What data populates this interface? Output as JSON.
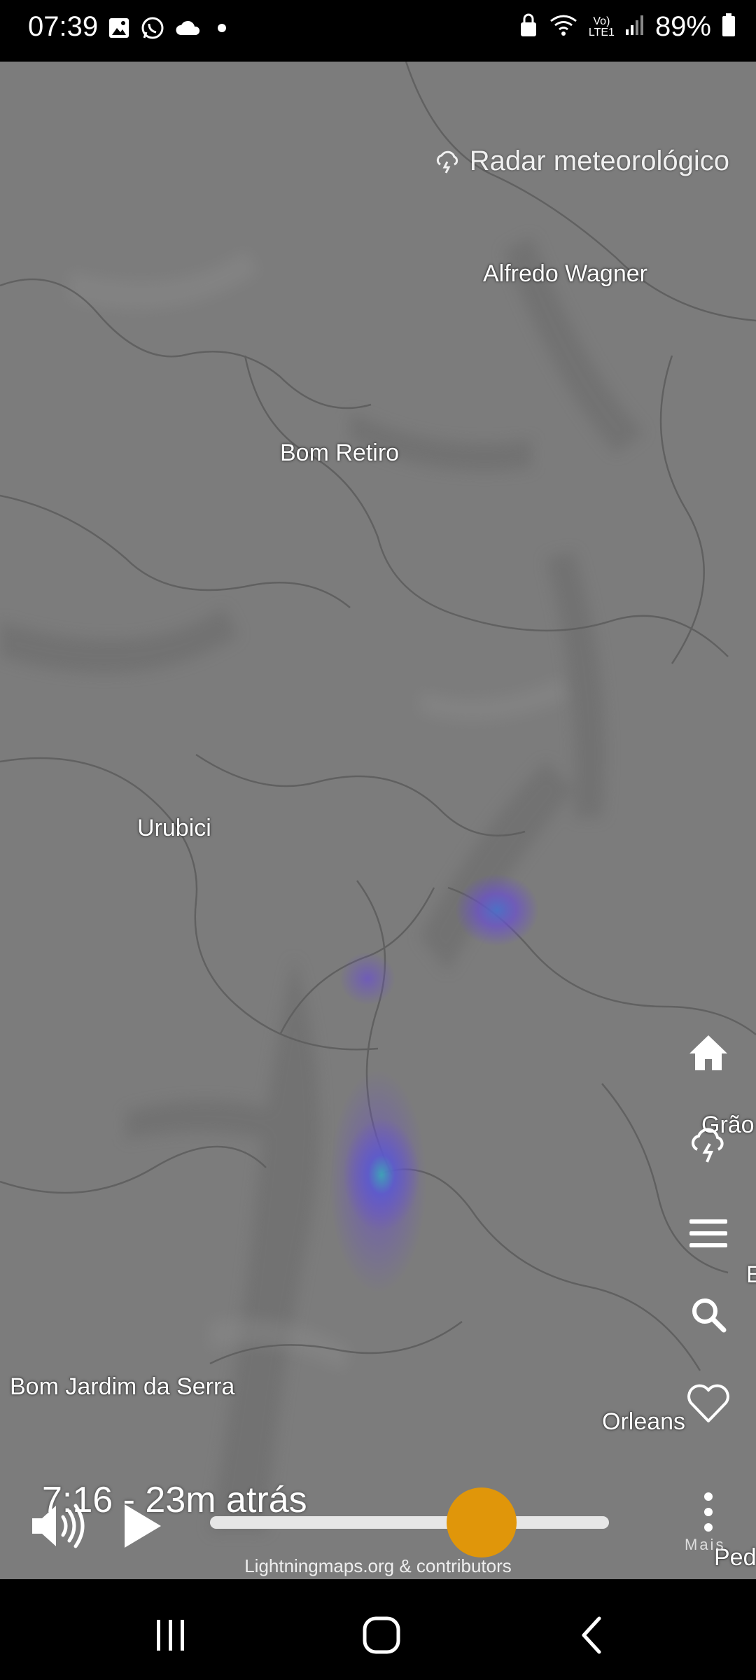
{
  "status_bar": {
    "time": "07:39",
    "battery_percent": "89%",
    "icons_left": [
      "gallery-icon",
      "whatsapp-icon",
      "cloud-icon",
      "dot-icon"
    ],
    "icons_right": [
      "lock-icon",
      "wifi-icon",
      "volte-icon",
      "signal-icon",
      "battery-icon"
    ],
    "volte_text": "Vo)\nLTE1"
  },
  "map": {
    "layer_title": "Radar meteorológico",
    "places": {
      "alfredo_wagner": "Alfredo Wagner",
      "bom_retiro": "Bom Retiro",
      "urubici": "Urubici",
      "bom_jardim": "Bom Jardim da Serra",
      "orleans": "Orleans",
      "grao": "Grão",
      "ped": "Ped",
      "e_partial": "E"
    },
    "timestamp": "7:16 - 23m atrás",
    "attribution": "Lightningmaps.org & contributors",
    "more_label": "Mais"
  },
  "playback": {
    "progress": 0.68
  },
  "side_buttons": [
    "home-icon",
    "lightning-layer-icon",
    "menu-icon",
    "search-icon",
    "favorite-icon"
  ],
  "colors": {
    "accent": "#e0960a",
    "map_base": "#7a7a7a",
    "radar": "#6a4fd0"
  }
}
